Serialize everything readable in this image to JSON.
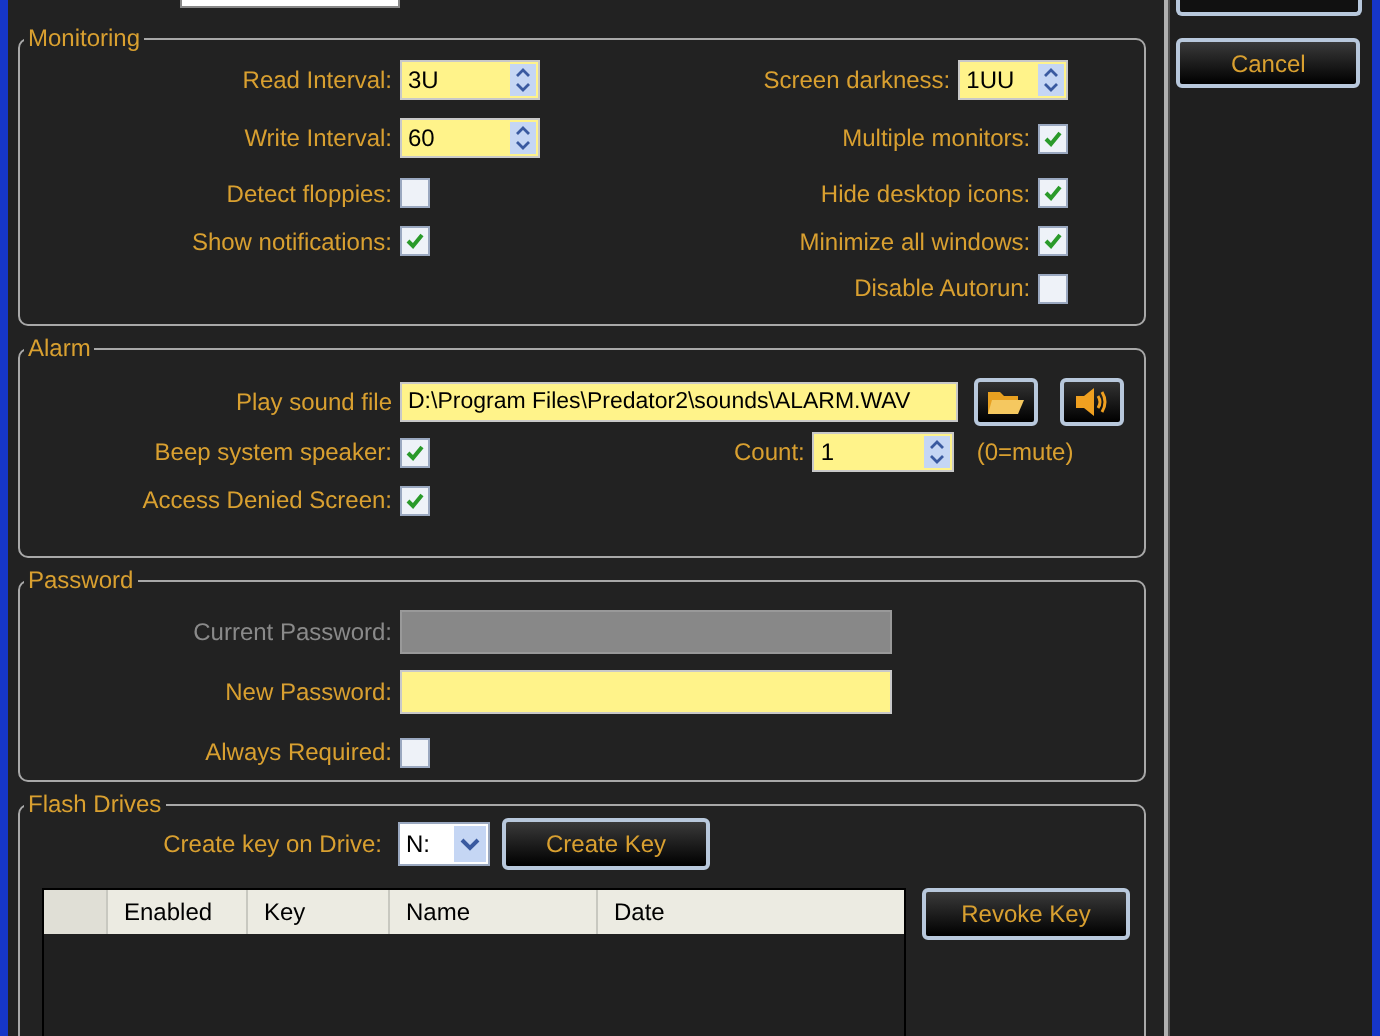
{
  "monitoring": {
    "title": "Monitoring",
    "left": [
      {
        "kind": "spinner",
        "label": "Read Interval:",
        "value": "3U"
      },
      {
        "kind": "spinner",
        "label": "Write Interval:",
        "value": "60"
      },
      {
        "kind": "checkbox",
        "label": "Detect floppies:",
        "checked": false
      },
      {
        "kind": "checkbox",
        "label": "Show notifications:",
        "checked": true
      }
    ],
    "right": [
      {
        "kind": "spinner",
        "label": "Screen darkness:",
        "value": "1UU"
      },
      {
        "kind": "checkbox",
        "label": "Multiple monitors:",
        "checked": true
      },
      {
        "kind": "checkbox",
        "label": "Hide desktop icons:",
        "checked": true
      },
      {
        "kind": "checkbox",
        "label": "Minimize all windows:",
        "checked": true
      },
      {
        "kind": "checkbox",
        "label": "Disable Autorun:",
        "checked": false
      }
    ]
  },
  "alarm": {
    "title": "Alarm",
    "sound_file": {
      "label": "Play sound file",
      "value": "D:\\Program Files\\Predator2\\sounds\\ALARM.WAV"
    },
    "beep": {
      "label": "Beep system speaker:",
      "checked": true
    },
    "count": {
      "label": "Count:",
      "value": "1",
      "note": "(0=mute)"
    },
    "access_denied": {
      "label": "Access Denied Screen:",
      "checked": true
    }
  },
  "password": {
    "title": "Password",
    "rows": [
      {
        "kind": "field",
        "label": "Current Password:",
        "disabled": true
      },
      {
        "kind": "field",
        "label": "New Password:",
        "disabled": false
      },
      {
        "kind": "checkbox",
        "label": "Always Required:",
        "checked": false
      }
    ]
  },
  "flash_drives": {
    "title": "Flash Drives",
    "create_label": "Create key on Drive:",
    "drive": "N:",
    "create_button": "Create Key",
    "table": {
      "columns": [
        "Enabled",
        "Key",
        "Name",
        "Date"
      ]
    },
    "revoke_button": "Revoke Key"
  },
  "cancel_button": "Cancel"
}
